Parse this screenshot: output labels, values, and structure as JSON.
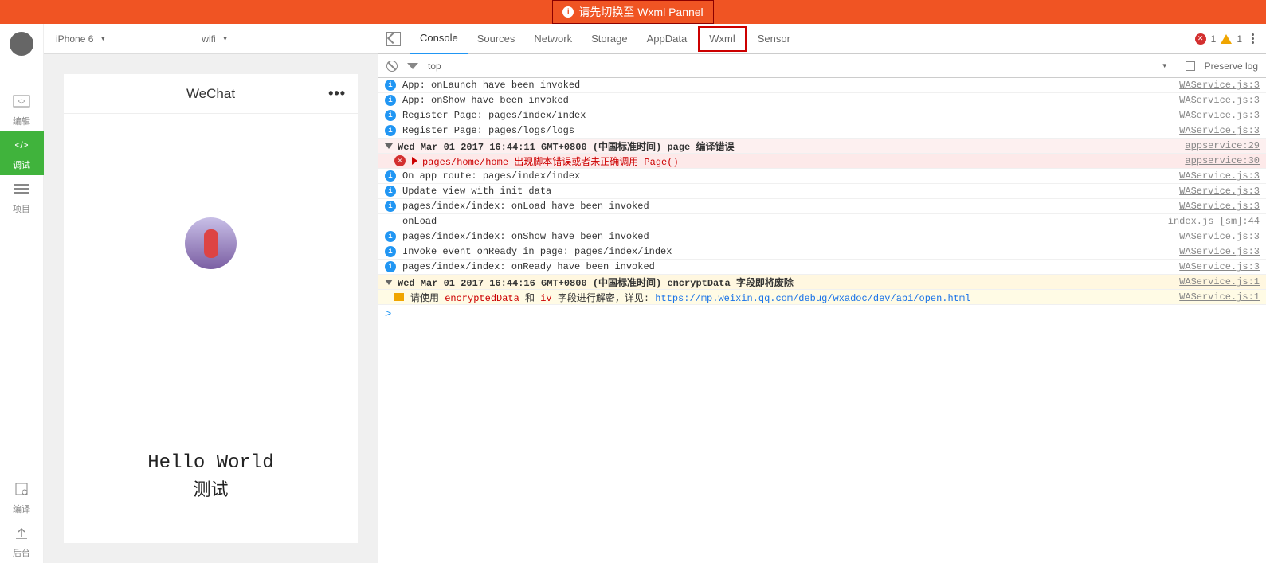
{
  "banner": {
    "text": "请先切换至 Wxml Pannel"
  },
  "rail": {
    "edit": "编辑",
    "debug": "调试",
    "project": "项目",
    "compile": "编译",
    "backend": "后台"
  },
  "simulator": {
    "device": "iPhone 6",
    "network": "wifi",
    "app_title": "WeChat",
    "hello": "Hello World",
    "test": "测试"
  },
  "tabs": {
    "console": "Console",
    "sources": "Sources",
    "network": "Network",
    "storage": "Storage",
    "appdata": "AppData",
    "wxml": "Wxml",
    "sensor": "Sensor"
  },
  "status": {
    "err_count": "1",
    "warn_count": "1"
  },
  "filter": {
    "scope": "top",
    "preserve": "Preserve log"
  },
  "logs": [
    {
      "type": "info",
      "msg": "App: onLaunch have been invoked",
      "src": "WAService.js:3"
    },
    {
      "type": "info",
      "msg": "App: onShow have been invoked",
      "src": "WAService.js:3"
    },
    {
      "type": "info",
      "msg": "Register Page: pages/index/index",
      "src": "WAService.js:3"
    },
    {
      "type": "info",
      "msg": "Register Page: pages/logs/logs",
      "src": "WAService.js:3"
    },
    {
      "type": "group",
      "msg": "Wed Mar 01 2017 16:44:11 GMT+0800 (中国标准时间) page 编译错误",
      "src": "appservice:29"
    },
    {
      "type": "error",
      "msg_a": "pages/home/home",
      "msg_b": " 出现脚本错误或者未正确调用 Page()",
      "src": "appservice:30"
    },
    {
      "type": "info",
      "msg": "On app route: pages/index/index",
      "src": "WAService.js:3"
    },
    {
      "type": "info",
      "msg": "Update view with init data",
      "src": "WAService.js:3"
    },
    {
      "type": "info",
      "msg": "pages/index/index: onLoad have been invoked",
      "src": "WAService.js:3"
    },
    {
      "type": "plain",
      "msg": "onLoad",
      "src": "index.js [sm]:44"
    },
    {
      "type": "info",
      "msg": "pages/index/index: onShow have been invoked",
      "src": "WAService.js:3"
    },
    {
      "type": "info",
      "msg": "Invoke event onReady in page: pages/index/index",
      "src": "WAService.js:3"
    },
    {
      "type": "info",
      "msg": "pages/index/index: onReady have been invoked",
      "src": "WAService.js:3"
    },
    {
      "type": "group-warn",
      "msg": "Wed Mar 01 2017 16:44:16 GMT+0800 (中国标准时间) encryptData 字段即将废除",
      "src": "WAService.js:1"
    },
    {
      "type": "warn",
      "msg_a": "请使用 ",
      "msg_b": "encryptedData",
      "msg_c": " 和 ",
      "msg_d": "iv",
      "msg_e": " 字段进行解密，详见: ",
      "link": "https://mp.weixin.qq.com/debug/wxadoc/dev/api/open.html",
      "src": "WAService.js:1"
    }
  ]
}
